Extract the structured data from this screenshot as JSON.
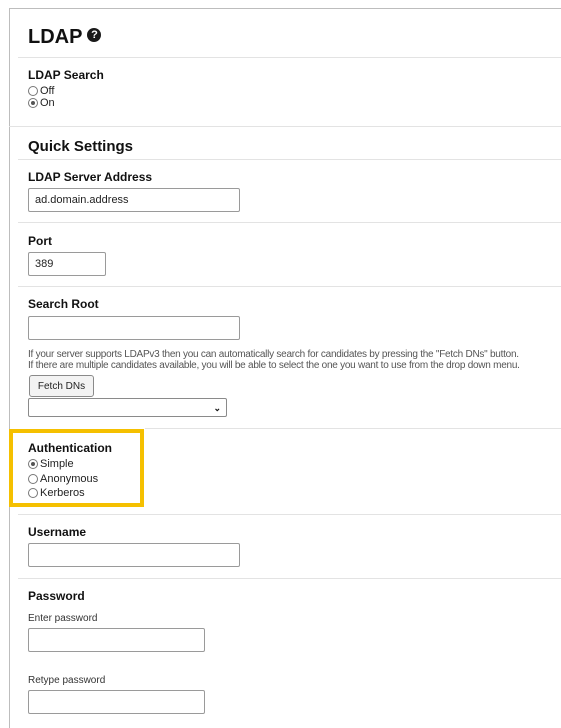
{
  "header": {
    "title": "LDAP",
    "help_icon": "help-icon"
  },
  "ldap_search": {
    "label": "LDAP Search",
    "options": [
      {
        "label": "Off",
        "checked": false
      },
      {
        "label": "On",
        "checked": true
      }
    ]
  },
  "quick_settings": {
    "title": "Quick Settings"
  },
  "server_address": {
    "label": "LDAP Server Address",
    "value": "ad.domain.address"
  },
  "port": {
    "label": "Port",
    "value": "389"
  },
  "search_root": {
    "label": "Search Root",
    "value": "",
    "help_line1": "If your server supports LDAPv3 then you can automatically search for candidates by pressing the \"Fetch DNs\" button.",
    "help_line2": "If there are multiple candidates available, you will be able to select the one you want to use from the drop down menu.",
    "fetch_button": "Fetch DNs",
    "select_value": ""
  },
  "authentication": {
    "label": "Authentication",
    "highlight_color": "#f5c000",
    "options": [
      {
        "label": "Simple",
        "checked": true
      },
      {
        "label": "Anonymous",
        "checked": false
      },
      {
        "label": "Kerberos",
        "checked": false
      }
    ]
  },
  "username": {
    "label": "Username",
    "value": ""
  },
  "password": {
    "label": "Password",
    "enter_label": "Enter password",
    "retype_label": "Retype password"
  }
}
